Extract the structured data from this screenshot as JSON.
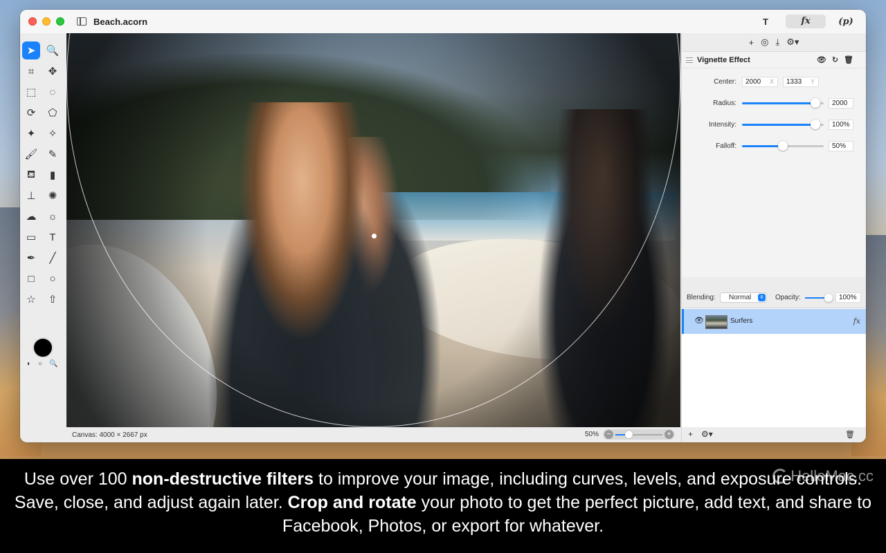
{
  "window": {
    "title": "Beach.acorn",
    "toolbar_tools": [
      "T",
      "fx",
      "(p)"
    ]
  },
  "tools": [
    {
      "name": "select-tool",
      "glyph": "➤"
    },
    {
      "name": "zoom-tool",
      "glyph": "🔍"
    },
    {
      "name": "crop-tool",
      "glyph": "⌗"
    },
    {
      "name": "transform-tool",
      "glyph": "✥"
    },
    {
      "name": "rect-select-tool",
      "glyph": "⬚"
    },
    {
      "name": "ellipse-select-tool",
      "glyph": "◌"
    },
    {
      "name": "lasso-tool",
      "glyph": "⟳"
    },
    {
      "name": "polygon-lasso-tool",
      "glyph": "⬠"
    },
    {
      "name": "magic-wand-tool",
      "glyph": "✦"
    },
    {
      "name": "instant-alpha-tool",
      "glyph": "✧"
    },
    {
      "name": "brush-tool",
      "glyph": "🖌"
    },
    {
      "name": "pencil-tool",
      "glyph": "✎"
    },
    {
      "name": "paint-bucket-tool",
      "glyph": "⛾"
    },
    {
      "name": "eraser-tool",
      "glyph": "▮"
    },
    {
      "name": "clone-tool",
      "glyph": "⊥"
    },
    {
      "name": "splat-tool",
      "glyph": "✺"
    },
    {
      "name": "cloud-tool",
      "glyph": "☁"
    },
    {
      "name": "sun-tool",
      "glyph": "☼"
    },
    {
      "name": "gradient-tool",
      "glyph": "▭"
    },
    {
      "name": "text-tool",
      "glyph": "T"
    },
    {
      "name": "pen-tool",
      "glyph": "✒"
    },
    {
      "name": "line-tool",
      "glyph": "╱"
    },
    {
      "name": "rectangle-shape-tool",
      "glyph": "□"
    },
    {
      "name": "oval-shape-tool",
      "glyph": "○"
    },
    {
      "name": "star-tool",
      "glyph": "☆"
    },
    {
      "name": "arrow-tool",
      "glyph": "⇧"
    }
  ],
  "status": {
    "canvas_info": "Canvas: 4000 × 2667 px",
    "zoom": "50%",
    "zoom_level": 0.25
  },
  "panel": {
    "toolbar_icons": [
      "+",
      "◎",
      "⤓",
      "⚙▾"
    ],
    "filter": {
      "title": "Vignette Effect",
      "center_label": "Center:",
      "center_x": "2000",
      "center_x_suffix": "X",
      "center_y": "1333",
      "center_y_suffix": "Y",
      "params": [
        {
          "label": "Radius:",
          "value": "2000",
          "fraction": 0.95
        },
        {
          "label": "Intensity:",
          "value": "100%",
          "fraction": 0.95
        },
        {
          "label": "Falloff:",
          "value": "50%",
          "fraction": 0.5
        }
      ]
    },
    "blending_label": "Blending:",
    "blending_mode": "Normal",
    "opacity_label": "Opacity:",
    "opacity_value": "100%",
    "opacity_fraction": 1.0,
    "layers": [
      {
        "name": "Surfers",
        "fx": "fx"
      }
    ]
  },
  "caption": {
    "part1": "Use over 100 ",
    "bold1": "non-destructive filters",
    "part2": " to improve your image, including curves, levels, and exposure controls. Save, close, and adjust again later. ",
    "bold2": "Crop and rotate",
    "part3": " your photo to get the perfect picture, add text, and share to Facebook, Photos, or export for whatever."
  },
  "watermark": "HelloMac.cc"
}
